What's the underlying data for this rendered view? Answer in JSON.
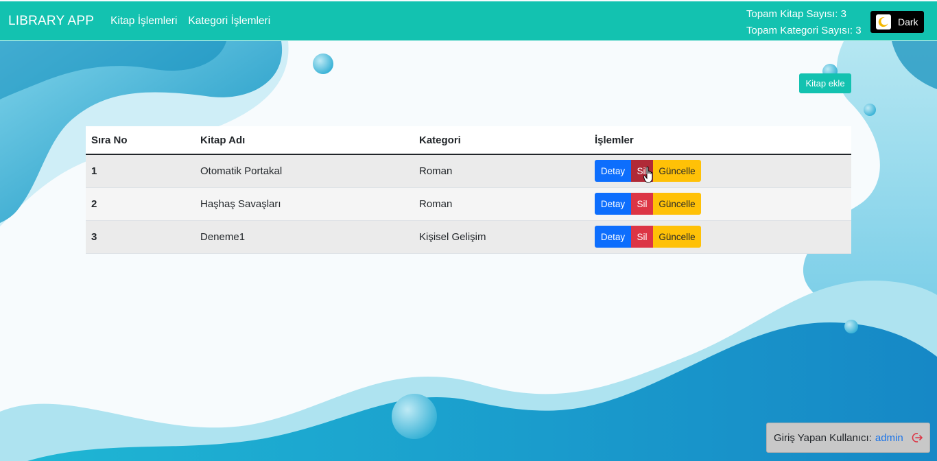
{
  "navbar": {
    "brand": "LIBRARY APP",
    "links": [
      "Kitap İşlemleri",
      "Kategori İşlemleri"
    ],
    "stats": {
      "book_count": "Topam Kitap Sayısı: 3",
      "category_count": "Topam Kategori Sayısı: 3"
    },
    "theme_toggle": {
      "label": "Dark",
      "icon": "moon-icon"
    }
  },
  "actions": {
    "add_book": "Kitap ekle"
  },
  "table": {
    "headers": [
      "Sıra No",
      "Kitap Adı",
      "Kategori",
      "İşlemler"
    ],
    "rows": [
      {
        "no": "1",
        "title": "Otomatik Portakal",
        "category": "Roman"
      },
      {
        "no": "2",
        "title": "Haşhaş Savaşları",
        "category": "Roman"
      },
      {
        "no": "3",
        "title": "Deneme1",
        "category": "Kişisel Gelişim"
      }
    ],
    "row_buttons": {
      "detail": "Detay",
      "delete": "Sil",
      "update": "Güncelle"
    }
  },
  "footer": {
    "logged_in_label": "Giriş Yapan Kullanıcı:",
    "username": "admin",
    "logout_icon": "logout-icon"
  },
  "colors": {
    "accent": "#13c2b0",
    "detail_button": "#0d6efd",
    "delete_button": "#dc3545",
    "update_button": "#ffc107",
    "username_link": "#1a73e8"
  }
}
